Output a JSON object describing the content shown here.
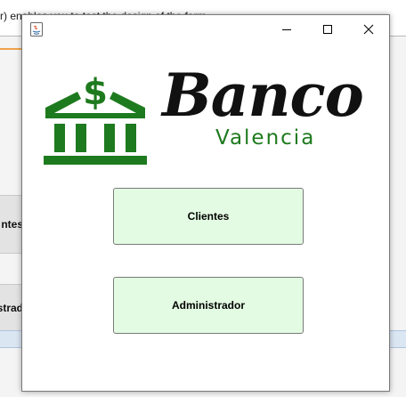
{
  "background": {
    "hint_text": "r) enables you to test the design of the form",
    "side_button_1": "ntes",
    "side_button_2": "strad"
  },
  "window": {
    "title": "",
    "controls": {
      "minimize_icon": "minimize-icon",
      "maximize_icon": "maximize-icon",
      "close_icon": "close-icon"
    }
  },
  "logo": {
    "word": "Banco",
    "sub": "Valencia",
    "icon": "bank-dollar-icon",
    "colors": {
      "green": "#1e7a1e",
      "dark": "#111111"
    }
  },
  "buttons": {
    "clientes": "Clientes",
    "administrador": "Administrador"
  },
  "colors": {
    "button_bg": "#e2fbe2",
    "button_border": "#7a7a7a"
  }
}
